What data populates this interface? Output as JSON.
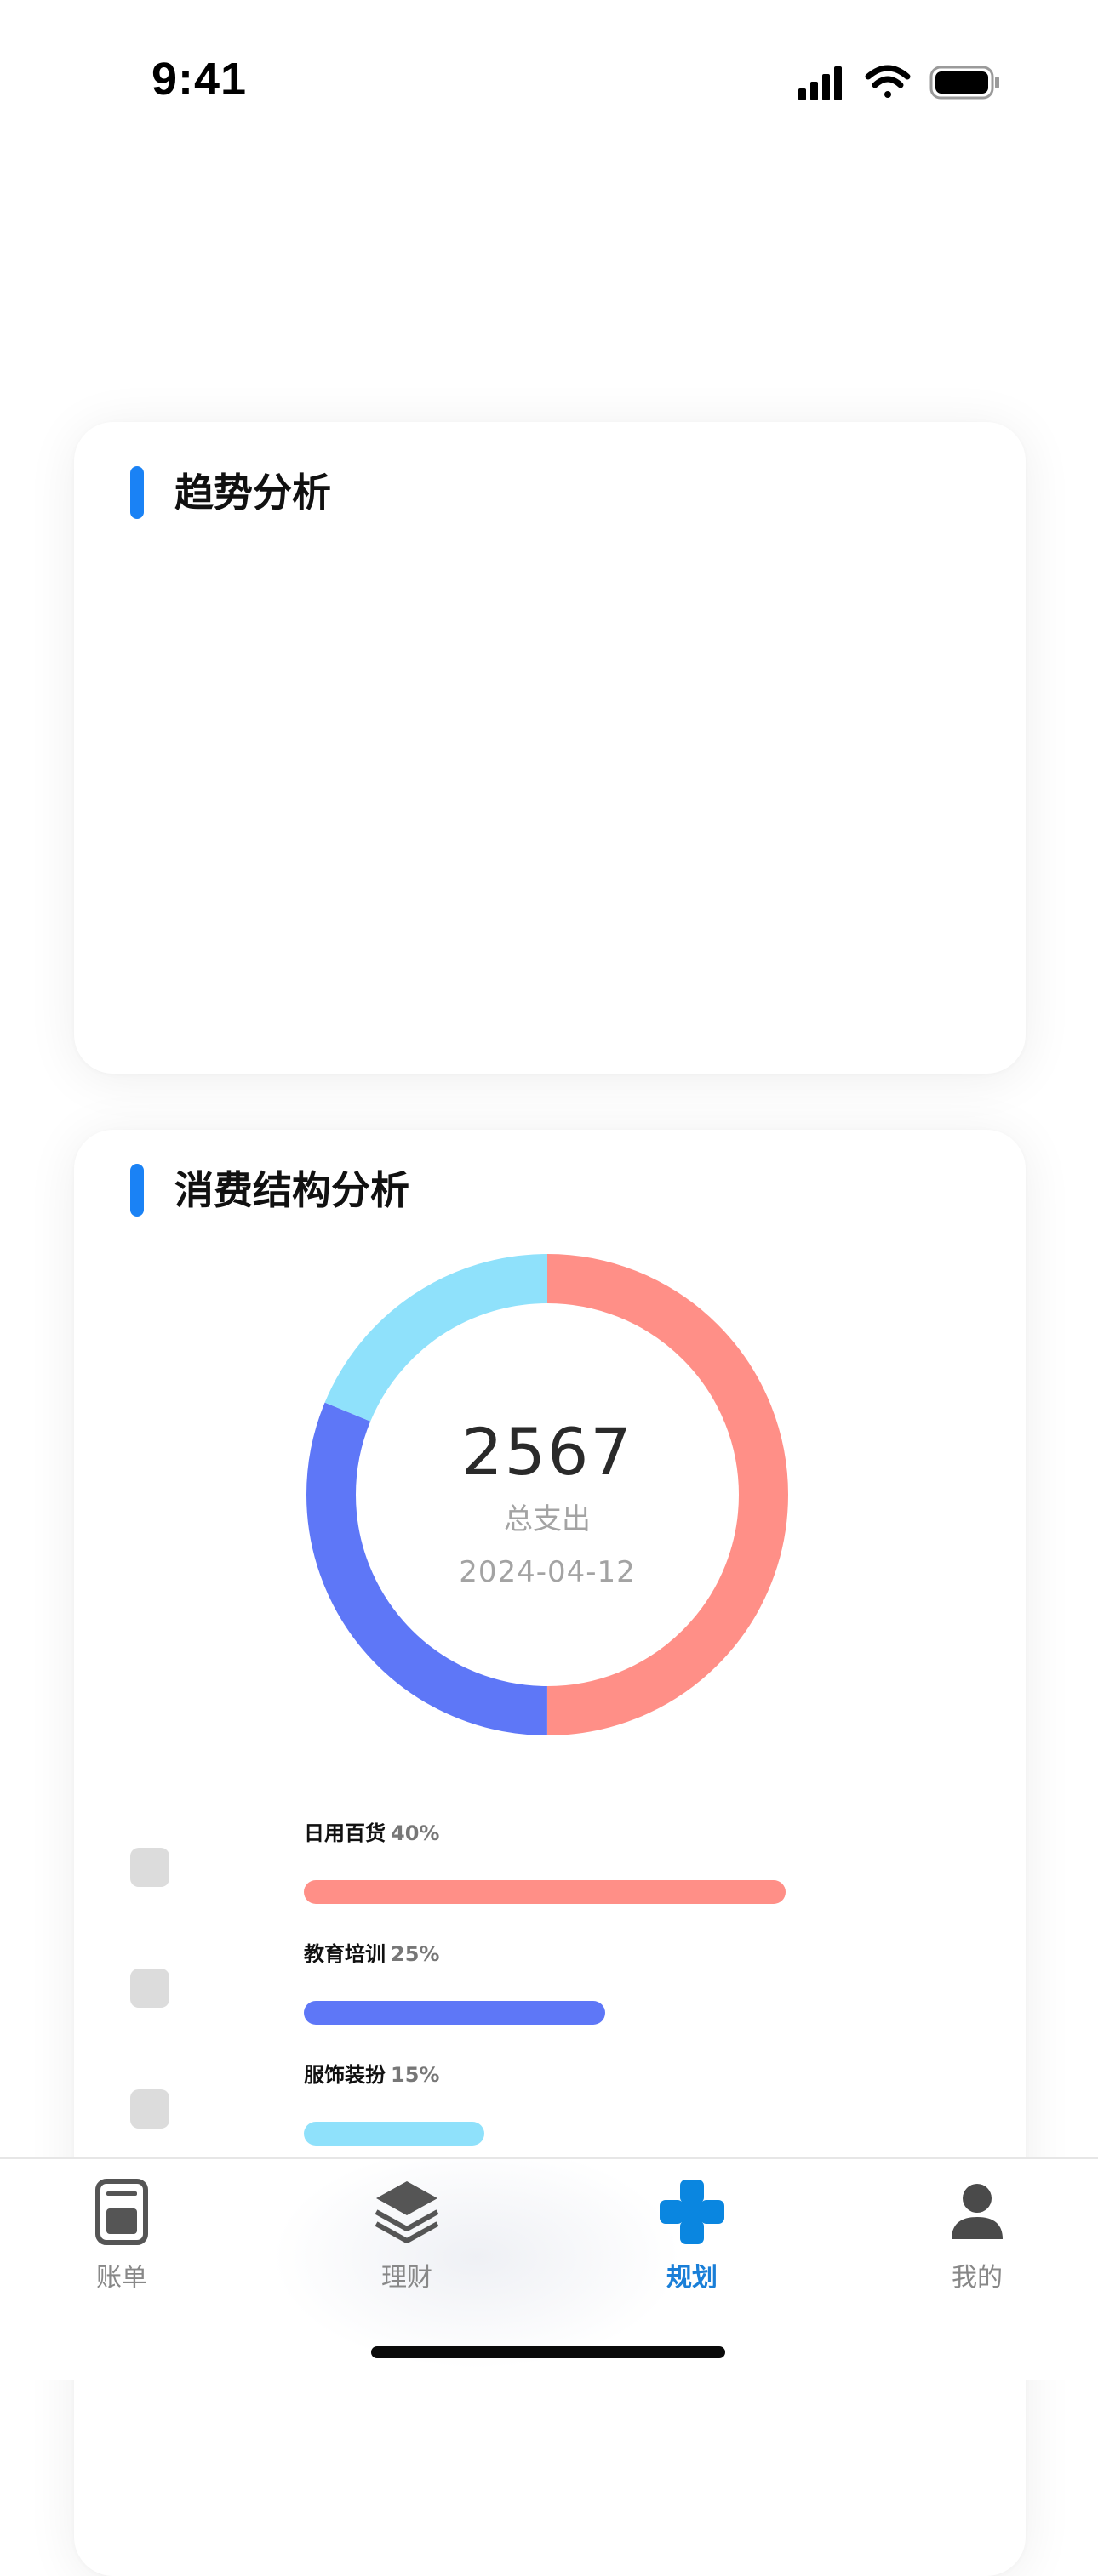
{
  "status_bar": {
    "time": "9:41",
    "icons": [
      "cellular-signal-icon",
      "wifi-icon",
      "battery-icon"
    ]
  },
  "trend_card": {
    "title": "趋势分析"
  },
  "structure_card": {
    "title": "消费结构分析",
    "donut": {
      "total": "2567",
      "total_label": "总支出",
      "date": "2024-04-12"
    },
    "categories": [
      {
        "name": "日用百货",
        "percent": "40%",
        "value": 40,
        "color": "#ff8f87"
      },
      {
        "name": "教育培训",
        "percent": "25%",
        "value": 25,
        "color": "#5e77f7"
      },
      {
        "name": "服饰装扮",
        "percent": "15%",
        "value": 15,
        "color": "#8fe1fb"
      }
    ]
  },
  "tab_bar": {
    "tabs": [
      {
        "label": "账单",
        "icon": "bill-icon",
        "active": false
      },
      {
        "label": "理财",
        "icon": "layers-icon",
        "active": false
      },
      {
        "label": "规划",
        "icon": "plan-cross-icon",
        "active": true
      },
      {
        "label": "我的",
        "icon": "user-icon",
        "active": false
      }
    ]
  },
  "colors": {
    "accent": "#1a82f5",
    "active_tab": "#1a7fd8",
    "inactive_tab": "#888888"
  }
}
